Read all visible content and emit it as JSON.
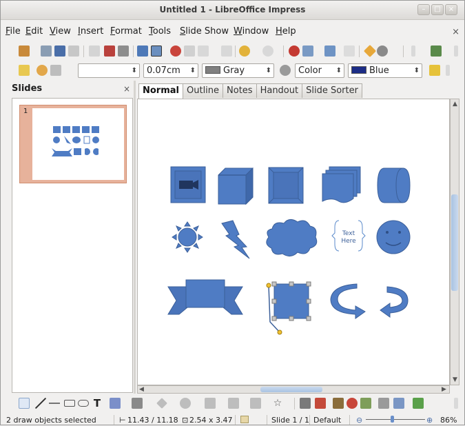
{
  "window": {
    "title": "Untitled 1 - LibreOffice Impress"
  },
  "menu": {
    "items": [
      "File",
      "Edit",
      "View",
      "Insert",
      "Format",
      "Tools",
      "Slide Show",
      "Window",
      "Help"
    ],
    "close_symbol": "×"
  },
  "formatting": {
    "line_width": "0.07cm",
    "line_color": "Gray",
    "area_type": "Color",
    "area_color": "Blue",
    "line_color_hex": "#808080",
    "area_color_hex": "#1c2d86"
  },
  "slides_pane": {
    "title": "Slides",
    "close_symbol": "×",
    "slide_number": "1"
  },
  "view_tabs": [
    "Normal",
    "Outline",
    "Notes",
    "Handout",
    "Slide Sorter"
  ],
  "shapes": {
    "fill_color": "#4f7cc4",
    "stroke_color": "#3b5f99",
    "callout_text_line1": "Text",
    "callout_text_line2": "Here"
  },
  "status": {
    "selection": "2 draw objects selected",
    "position": "11.43 / 11.18",
    "size": "2.54 x 3.47",
    "slide": "Slide 1 / 1",
    "layout": "Default",
    "zoom": "86%"
  }
}
